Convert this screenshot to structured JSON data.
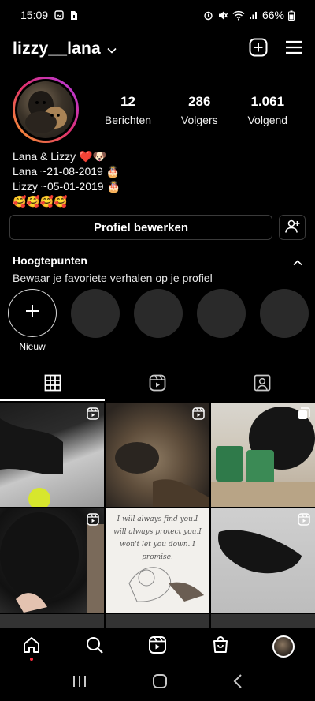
{
  "status_bar": {
    "time": "15:09",
    "battery": "66%",
    "icons": [
      "photo-icon",
      "sim-icon",
      "alarm-icon",
      "mute-icon",
      "wifi-icon",
      "signal-icon",
      "battery-icon"
    ]
  },
  "header": {
    "username": "lizzy__lana",
    "actions": [
      "new-post-icon",
      "menu-icon"
    ]
  },
  "profile": {
    "stats": [
      {
        "value": "12",
        "label": "Berichten"
      },
      {
        "value": "286",
        "label": "Volgers"
      },
      {
        "value": "1.061",
        "label": "Volgend"
      }
    ],
    "bio": {
      "name": "Lana & Lizzy ❤️🐶",
      "line1": "Lana ~21-08-2019 🎂",
      "line2": "Lizzy ~05-01-2019 🎂",
      "line3": "🥰🥰🥰🥰"
    },
    "edit_button": "Profiel bewerken"
  },
  "highlights": {
    "title": "Hoogtepunten",
    "subtitle": "Bewaar je favoriete verhalen op je profiel",
    "new_label": "Nieuw",
    "placeholders": 4
  },
  "tabs": [
    {
      "name": "grid",
      "icon": "grid-icon",
      "active": true
    },
    {
      "name": "reels",
      "icon": "reels-icon",
      "active": false
    },
    {
      "name": "tagged",
      "icon": "tagged-icon",
      "active": false
    }
  ],
  "grid_posts": [
    {
      "type": "reel"
    },
    {
      "type": "reel"
    },
    {
      "type": "carousel"
    },
    {
      "type": "reel"
    },
    {
      "type": "image",
      "quote": "I will always find you.I will always protect you.I won't let you down. I promise."
    },
    {
      "type": "reel"
    }
  ],
  "bottom_nav": [
    "home-icon",
    "search-icon",
    "reels-icon",
    "shop-icon",
    "profile-avatar"
  ],
  "colors": {
    "background": "#000000",
    "text": "#ffffff",
    "notification_dot": "#ff3040",
    "story_ring_start": "#f9a22b",
    "story_ring_end": "#b23aee"
  }
}
